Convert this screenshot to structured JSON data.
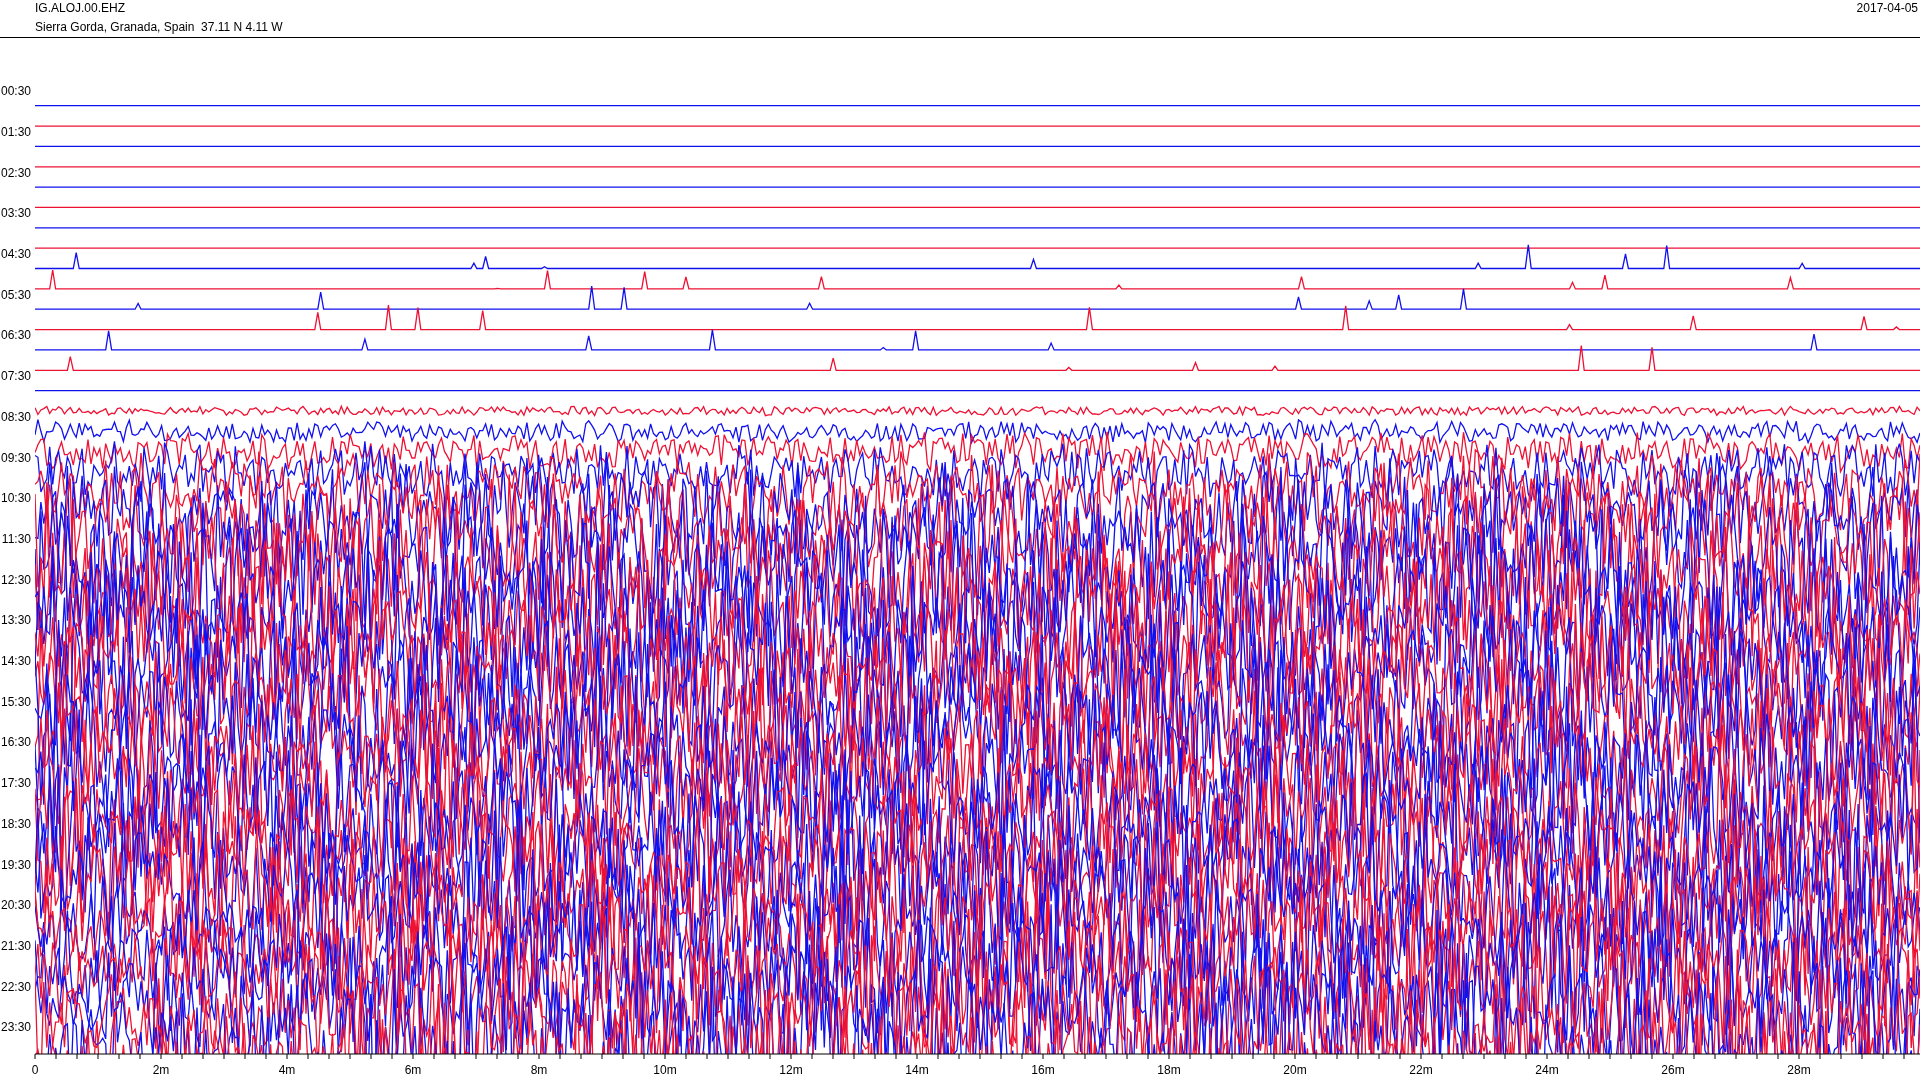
{
  "header": {
    "channel": "IG.ALOJ.00.EHZ",
    "location": "Sierra Gorda, Granada, Spain  37.11 N 4.11 W",
    "date": "2017-04-05"
  },
  "helicorder": {
    "time_labels": [
      "00:30",
      "01:30",
      "02:30",
      "03:30",
      "04:30",
      "05:30",
      "06:30",
      "07:30",
      "08:30",
      "09:30",
      "10:30",
      "11:30",
      "12:30",
      "13:30",
      "14:30",
      "15:30",
      "16:30",
      "17:30",
      "18:30",
      "19:30",
      "20:30",
      "21:30",
      "22:30",
      "23:30"
    ],
    "minute_labels": [
      "0",
      "2m",
      "4m",
      "6m",
      "8m",
      "10m",
      "12m",
      "14m",
      "16m",
      "18m",
      "20m",
      "22m",
      "24m",
      "26m",
      "28m"
    ]
  }
}
